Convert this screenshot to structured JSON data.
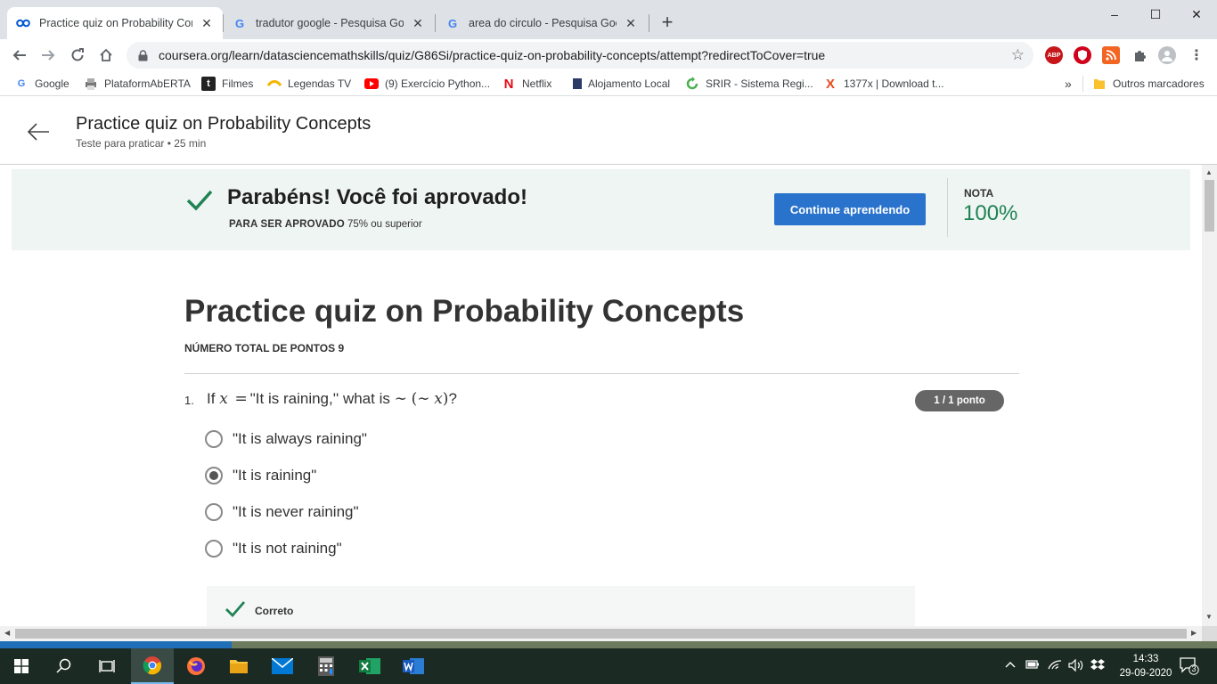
{
  "browser": {
    "tabs": [
      {
        "title": "Practice quiz on Probability Conc",
        "favicon": "coursera-icon",
        "active": true
      },
      {
        "title": "tradutor google - Pesquisa Goog",
        "favicon": "google-icon",
        "active": false
      },
      {
        "title": "area do circulo - Pesquisa Google",
        "favicon": "google-icon",
        "active": false
      }
    ],
    "new_tab": "+",
    "window_controls": {
      "minimize": "–",
      "maximize": "☐",
      "close": "✕"
    },
    "url": "coursera.org/learn/datasciencemathskills/quiz/G86Si/practice-quiz-on-probability-concepts/attempt?redirectToCover=true",
    "extensions": {
      "abp": "ABP"
    }
  },
  "bookmarks": {
    "items": [
      {
        "label": "Google",
        "icon": "google-icon"
      },
      {
        "label": "PlataformAbERTA",
        "icon": "printer-icon"
      },
      {
        "label": "Filmes",
        "icon": "tumblr-icon"
      },
      {
        "label": "Legendas TV",
        "icon": "legendas-icon"
      },
      {
        "label": "(9) Exercício Python...",
        "icon": "youtube-icon"
      },
      {
        "label": "Netflix",
        "icon": "netflix-icon"
      },
      {
        "label": "Alojamento Local",
        "icon": "flag-icon"
      },
      {
        "label": "SRIR - Sistema Regi...",
        "icon": "srir-icon"
      },
      {
        "label": "1377x | Download t...",
        "icon": "x-icon"
      }
    ],
    "overflow": "»",
    "other": "Outros marcadores"
  },
  "header": {
    "title": "Practice quiz on Probability Concepts",
    "subtitle": "Teste para praticar • 25 min"
  },
  "banner": {
    "message": "Parabéns! Você foi aprovado!",
    "requirement_label": "PARA SER APROVADO",
    "requirement_value": "75% ou superior",
    "cta": "Continue aprendendo",
    "grade_label": "NOTA",
    "grade_value": "100%",
    "colors": {
      "background": "#eef5f3",
      "success": "#1f8354",
      "button": "#2a73cc"
    }
  },
  "quiz": {
    "title": "Practice quiz on Probability Concepts",
    "total_points": "NÚMERO TOTAL DE PONTOS 9",
    "questions": [
      {
        "number": "1.",
        "text_prefix": "If",
        "var_x": "x",
        "equals": "=",
        "text_mid": "\"It is raining,'' what is",
        "expression": "∼ (∼ x)",
        "expression_not1": "∼",
        "expression_open": "(",
        "expression_not2": "∼",
        "expression_var": "x",
        "expression_close": ")",
        "qmark": "?",
        "score": "1 / 1 ponto",
        "options": [
          {
            "label": "\"It is always raining\"",
            "selected": false
          },
          {
            "label": "\"It is raining\"",
            "selected": true
          },
          {
            "label": "\"It is never raining\"",
            "selected": false
          },
          {
            "label": "\"It is not raining\"",
            "selected": false
          }
        ],
        "feedback": "Correto"
      }
    ]
  },
  "taskbar": {
    "clock_time": "14:33",
    "clock_date": "29-09-2020",
    "notification_count": "3"
  }
}
